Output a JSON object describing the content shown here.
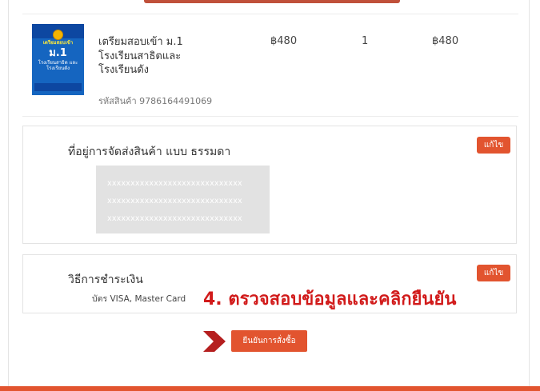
{
  "product": {
    "cover": {
      "line1": "เตรียมสอบเข้า",
      "line2": "ม.1",
      "line3": "โรงเรียนสาธิต และโรงเรียนดัง"
    },
    "title": "เตรียมสอบเข้า ม.1 โรงเรียนสาธิตและโรงเรียนดัง",
    "sku_label": "รหัสสินค้า",
    "sku": "9786164491069",
    "price": "฿480",
    "quantity": "1",
    "total": "฿480"
  },
  "shipping": {
    "title": "ที่อยู่การจัดส่งสินค้า แบบ ธรรมดา",
    "edit_label": "แก้ไข",
    "address_lines": [
      "xxxxxxxxxxxxxxxxxxxxxxxxxxxxx",
      "xxxxxxxxxxxxxxxxxxxxxxxxxxxxx",
      "xxxxxxxxxxxxxxxxxxxxxxxxxxxxx"
    ]
  },
  "payment": {
    "title": "วิธีการชำระเงิน",
    "edit_label": "แก้ไข",
    "method": "บัตร VISA, Master Card"
  },
  "annotation": "4. ตรวจสอบข้อมูลและคลิกยืนยัน",
  "confirm_label": "ยืนยันการสั่งซื้อ",
  "colors": {
    "accent": "#e2542f",
    "annotation": "#d11a1a",
    "book_cover": "#1565c0"
  }
}
